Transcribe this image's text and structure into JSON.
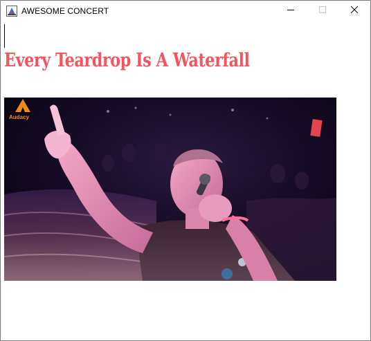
{
  "window": {
    "title": "AWESOME CONCERT",
    "icon": "app-window-icon",
    "controls": {
      "minimize_icon": "minimize-icon",
      "maximize_icon": "maximize-icon",
      "close_icon": "close-icon"
    }
  },
  "content": {
    "headline": "Every Teardrop Is A Waterfall",
    "headline_color": "#f35460"
  },
  "video": {
    "watermark_label": "Audacy",
    "watermark_color": "#f08a1a"
  }
}
